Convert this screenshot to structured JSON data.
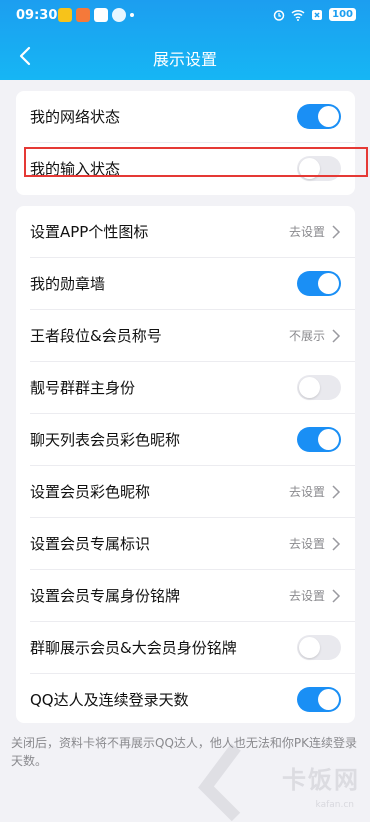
{
  "status_bar": {
    "time": "09:30",
    "battery": "100"
  },
  "header": {
    "title": "展示设置"
  },
  "group1": [
    {
      "label": "我的网络状态",
      "toggle": true
    },
    {
      "label": "我的输入状态",
      "toggle": false
    }
  ],
  "group2": [
    {
      "label": "设置APP个性图标",
      "value": "去设置"
    },
    {
      "label": "我的勋章墙",
      "toggle": true
    },
    {
      "label": "王者段位&会员称号",
      "value": "不展示"
    },
    {
      "label": "靓号群群主身份",
      "toggle": false
    },
    {
      "label": "聊天列表会员彩色昵称",
      "toggle": true
    },
    {
      "label": "设置会员彩色昵称",
      "value": "去设置"
    },
    {
      "label": "设置会员专属标识",
      "value": "去设置"
    },
    {
      "label": "设置会员专属身份铭牌",
      "value": "去设置"
    },
    {
      "label": "群聊展示会员&大会员身份铭牌",
      "toggle": false
    },
    {
      "label": "QQ达人及连续登录天数",
      "toggle": true
    }
  ],
  "footer_note": "关闭后，资料卡将不再展示QQ达人，他人也无法和你PK连续登录天数。",
  "watermark": {
    "text": "卡饭网",
    "sub": "kafan.cn"
  },
  "colors": {
    "accent": "#1a8ff5",
    "header": "#1c9ef0",
    "highlight": "#e53935"
  }
}
